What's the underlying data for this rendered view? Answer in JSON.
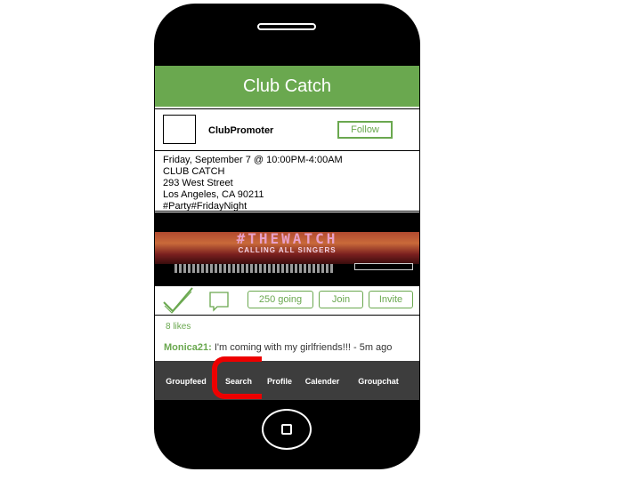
{
  "app": {
    "title": "Club Catch"
  },
  "post": {
    "poster_name": "ClubPromoter",
    "follow_label": "Follow",
    "details": [
      "Friday, September 7 @ 10:00PM-4:00AM",
      "CLUB CATCH",
      "293 West Street",
      "Los Angeles, CA 90211",
      "#Party#FridayNight"
    ],
    "banner": {
      "headline": "#THEWATCH",
      "subline": "CALLING ALL SINGERS"
    }
  },
  "actions": {
    "going_label": "250 going",
    "join_label": "Join",
    "invite_label": "Invite"
  },
  "likes": {
    "text": "8 likes"
  },
  "comment": {
    "user": "Monica21:",
    "text": " I'm coming with my girlfriends!!! - 5m ago"
  },
  "tabs": [
    {
      "label": "Groupfeed"
    },
    {
      "label": "Search"
    },
    {
      "label": "Profile"
    },
    {
      "label": "Calender"
    },
    {
      "label": "Groupchat"
    }
  ],
  "colors": {
    "accent": "#6aa84f",
    "highlight": "#ee0000",
    "tabbar": "#3d3d3d"
  }
}
